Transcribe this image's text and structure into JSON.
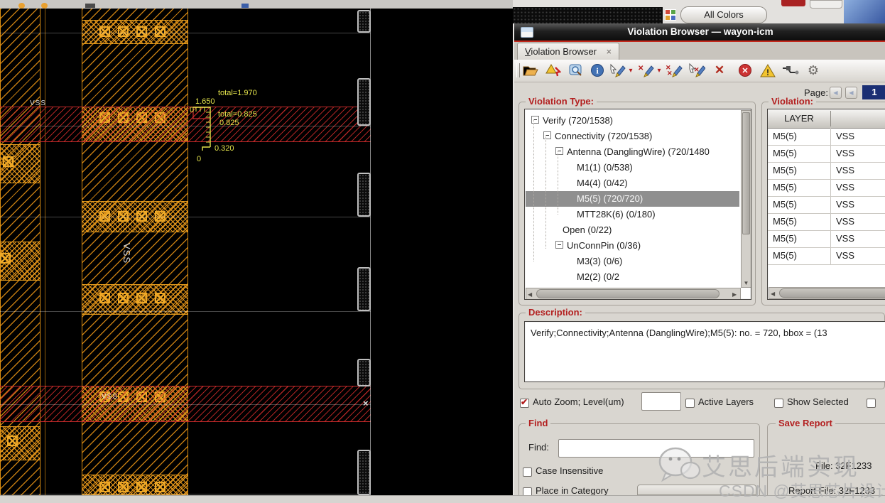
{
  "top_bar": {
    "all_colors_label": "All Colors"
  },
  "canvas": {
    "vss_left": "VSS",
    "vss_vertical": "VSS",
    "vss_band2": "VSS",
    "marker_x": "×",
    "ruler": {
      "total1": "total=1.970",
      "val1": "1.650",
      "zero_top": "0",
      "total2": "total=0.825",
      "val2": "0.825",
      "val3": "0.320",
      "zero_bottom": "0"
    }
  },
  "window": {
    "title": "Violation Browser — wayon-icm",
    "tab": {
      "label": "Violation Browser",
      "close": "×"
    },
    "toolbar": {
      "icons": [
        "open",
        "highlight-violation",
        "zoom-to-fit",
        "info",
        "select-next-marker",
        "dropdown",
        "prev-marker",
        "dropdown",
        "clear-markers",
        "select-marker",
        "delete",
        "disable",
        "warning",
        "probe",
        "settings"
      ]
    },
    "page": {
      "label": "Page:",
      "current": "1"
    },
    "violation_type": {
      "label": "Violation Type:",
      "tree": [
        {
          "text": "Verify (720/1538)",
          "depth": 0,
          "expand": true
        },
        {
          "text": "Connectivity (720/1538)",
          "depth": 1,
          "expand": true
        },
        {
          "text": "Antenna (DanglingWire) (720/1480",
          "depth": 2,
          "expand": true
        },
        {
          "text": "M1(1) (0/538)",
          "depth": 3
        },
        {
          "text": "M4(4) (0/42)",
          "depth": 3
        },
        {
          "text": "M5(5) (720/720)",
          "depth": 3,
          "selected": true
        },
        {
          "text": "MTT28K(6) (0/180)",
          "depth": 3
        },
        {
          "text": "Open (0/22)",
          "depth": 2
        },
        {
          "text": "UnConnPin (0/36)",
          "depth": 2,
          "expand": true
        },
        {
          "text": "M3(3) (0/6)",
          "depth": 3
        },
        {
          "text": "M2(2) (0/2",
          "depth": 3,
          "partial": true
        }
      ]
    },
    "violation": {
      "label": "Violation:",
      "columns": [
        "LAYER",
        ""
      ],
      "rows": [
        [
          "M5(5)",
          "VSS"
        ],
        [
          "M5(5)",
          "VSS"
        ],
        [
          "M5(5)",
          "VSS"
        ],
        [
          "M5(5)",
          "VSS"
        ],
        [
          "M5(5)",
          "VSS"
        ],
        [
          "M5(5)",
          "VSS"
        ],
        [
          "M5(5)",
          "VSS"
        ],
        [
          "M5(5)",
          "VSS"
        ]
      ]
    },
    "description": {
      "label": "Description:",
      "text": "Verify;Connectivity;Antenna (DanglingWire);M5(5): no. = 720, bbox = (13"
    },
    "options": {
      "auto_zoom_label": "Auto Zoom; Level(um)",
      "auto_zoom_checked": true,
      "level_value": "",
      "active_layers_label": "Active Layers",
      "active_layers_checked": false,
      "show_selected_label": "Show Selected",
      "show_selected_checked": false
    },
    "find": {
      "label": "Find",
      "find_label": "Find:",
      "find_value": "",
      "case_insensitive_label": "Case Insensitive",
      "place_in_category_label": "Place in Category"
    },
    "save_report": {
      "label": "Save Report",
      "line1": "File: 32F1233",
      "line2": "Report File: 32F1233"
    }
  },
  "watermark": {
    "line1": "艾思后端实现",
    "line2": "CSDN @艾思芯片设计"
  }
}
